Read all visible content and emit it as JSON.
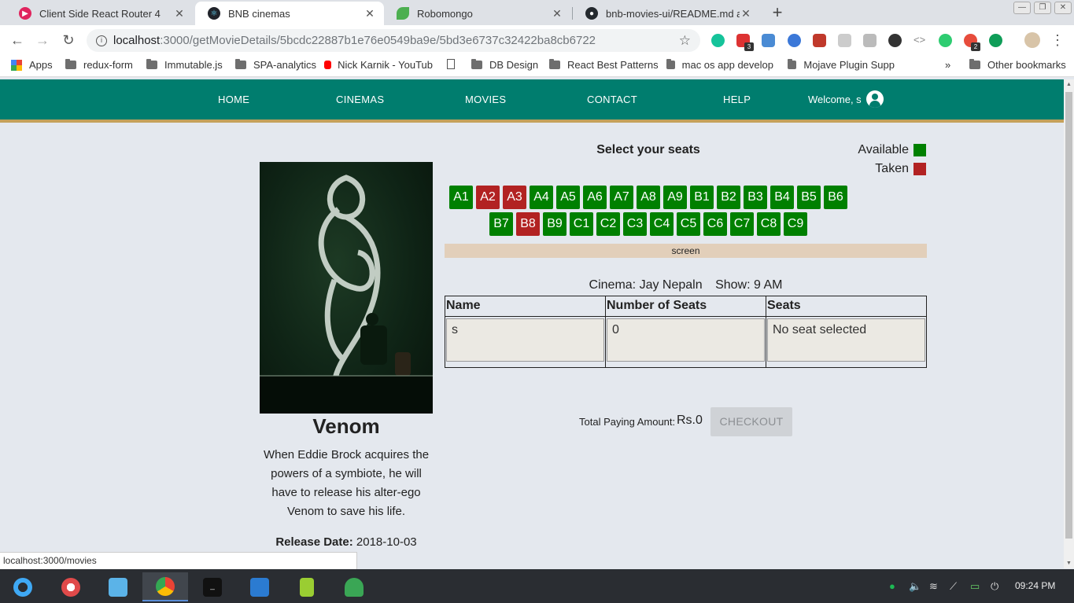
{
  "browser": {
    "tabs": [
      {
        "title": "Client Side React Router 4",
        "favicon": "play-circle-icon",
        "color": "#e0245e",
        "active": false
      },
      {
        "title": "BNB cinemas",
        "favicon": "react-icon",
        "color": "#20232a",
        "active": true
      },
      {
        "title": "Robomongo",
        "favicon": "leaf-icon",
        "color": "#4caf50",
        "active": false
      },
      {
        "title": "bnb-movies-ui/README.md at r",
        "favicon": "github-icon",
        "color": "#24292e",
        "active": false
      }
    ],
    "url_host": "localhost",
    "url_path": ":3000/getMovieDetails/5bcdc22887b1e76e0549ba9e/5bd3e6737c32422ba8cb6722",
    "extension_badges": [
      "3",
      "2"
    ],
    "bookmarks": [
      {
        "label": "Apps",
        "icon": "apps-grid-icon"
      },
      {
        "label": "redux-form",
        "icon": "folder-icon"
      },
      {
        "label": "Immutable.js",
        "icon": "folder-icon"
      },
      {
        "label": "SPA-analytics",
        "icon": "folder-icon"
      },
      {
        "label": "Nick Karnik - YouTub",
        "icon": "youtube-icon"
      },
      {
        "label": "",
        "icon": "page-icon"
      },
      {
        "label": "DB Design",
        "icon": "folder-icon"
      },
      {
        "label": "React Best Patterns",
        "icon": "folder-icon"
      },
      {
        "label": "mac os app develop",
        "icon": "folder-icon"
      },
      {
        "label": "Mojave Plugin Supp",
        "icon": "folder-icon"
      },
      {
        "label": "Other bookmarks",
        "icon": "folder-icon"
      }
    ],
    "bookmarks_overflow": "»",
    "status_url": "localhost:3000/movies"
  },
  "app": {
    "nav": [
      "HOME",
      "CINEMAS",
      "MOVIES",
      "CONTACT",
      "HELP"
    ],
    "welcome": "Welcome, s",
    "colors": {
      "primary": "#007d6e",
      "accent": "#c4a15a",
      "available": "#008000",
      "taken": "#b22222"
    }
  },
  "movie": {
    "title": "Venom",
    "description": "When Eddie Brock acquires the powers of a symbiote, he will have to release his alter-ego Venom to save his life.",
    "release_label": "Release Date:",
    "release_date": "2018-10-03"
  },
  "seating": {
    "title": "Select your seats",
    "legend_available": "Available",
    "legend_taken": "Taken",
    "rows": [
      [
        {
          "id": "A1",
          "taken": false
        },
        {
          "id": "A2",
          "taken": true
        },
        {
          "id": "A3",
          "taken": true
        },
        {
          "id": "A4",
          "taken": false
        },
        {
          "id": "A5",
          "taken": false
        },
        {
          "id": "A6",
          "taken": false
        },
        {
          "id": "A7",
          "taken": false
        },
        {
          "id": "A8",
          "taken": false
        },
        {
          "id": "A9",
          "taken": false
        },
        {
          "id": "B1",
          "taken": false
        },
        {
          "id": "B2",
          "taken": false
        },
        {
          "id": "B3",
          "taken": false
        },
        {
          "id": "B4",
          "taken": false
        },
        {
          "id": "B5",
          "taken": false
        },
        {
          "id": "B6",
          "taken": false
        }
      ],
      [
        {
          "id": "B7",
          "taken": false
        },
        {
          "id": "B8",
          "taken": true
        },
        {
          "id": "B9",
          "taken": false
        },
        {
          "id": "C1",
          "taken": false
        },
        {
          "id": "C2",
          "taken": false
        },
        {
          "id": "C3",
          "taken": false
        },
        {
          "id": "C4",
          "taken": false
        },
        {
          "id": "C5",
          "taken": false
        },
        {
          "id": "C6",
          "taken": false
        },
        {
          "id": "C7",
          "taken": false
        },
        {
          "id": "C8",
          "taken": false
        },
        {
          "id": "C9",
          "taken": false
        }
      ]
    ],
    "screen_label": "screen"
  },
  "show": {
    "cinema": "Cinema: Jay Nepaln",
    "time": "Show: 9 AM"
  },
  "booking": {
    "headers": [
      "Name",
      "Number of Seats",
      "Seats"
    ],
    "values": [
      "s",
      "0",
      "No seat selected"
    ]
  },
  "checkout": {
    "total_label": "Total Paying Amount:",
    "total_amount": "Rs.0",
    "button_label": "CHECKOUT"
  },
  "taskbar": {
    "clock": "09:24 PM"
  }
}
